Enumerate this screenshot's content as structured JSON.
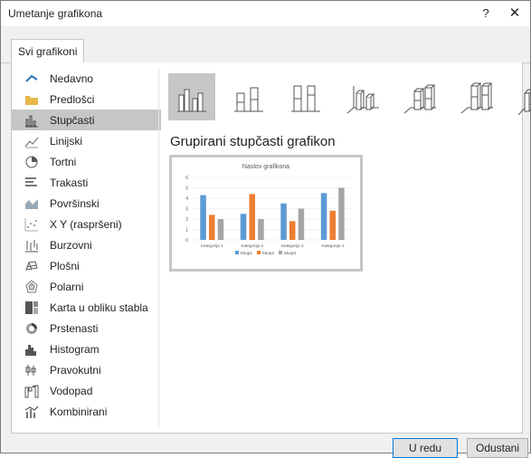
{
  "dialog": {
    "title": "Umetanje grafikona",
    "help_label": "?",
    "close_label": "✕"
  },
  "tab": {
    "label": "Svi grafikoni"
  },
  "categories": [
    {
      "label": "Nedavno",
      "icon": "recent-icon"
    },
    {
      "label": "Predlošci",
      "icon": "folder-icon"
    },
    {
      "label": "Stupčasti",
      "icon": "column-chart-icon",
      "selected": true
    },
    {
      "label": "Linijski",
      "icon": "line-chart-icon"
    },
    {
      "label": "Tortni",
      "icon": "pie-chart-icon"
    },
    {
      "label": "Trakasti",
      "icon": "bar-chart-icon"
    },
    {
      "label": "Površinski",
      "icon": "area-chart-icon"
    },
    {
      "label": "X Y (raspršeni)",
      "icon": "scatter-chart-icon"
    },
    {
      "label": "Burzovni",
      "icon": "stock-chart-icon"
    },
    {
      "label": "Plošni",
      "icon": "surface-chart-icon"
    },
    {
      "label": "Polarni",
      "icon": "radar-chart-icon"
    },
    {
      "label": "Karta u obliku stabla",
      "icon": "treemap-chart-icon"
    },
    {
      "label": "Prstenasti",
      "icon": "sunburst-chart-icon"
    },
    {
      "label": "Histogram",
      "icon": "histogram-chart-icon"
    },
    {
      "label": "Pravokutni",
      "icon": "box-whisker-chart-icon"
    },
    {
      "label": "Vodopad",
      "icon": "waterfall-chart-icon"
    },
    {
      "label": "Kombinirani",
      "icon": "combo-chart-icon"
    }
  ],
  "subtypes_selected_index": 0,
  "chart_type_heading": "Grupirani stupčasti grafikon",
  "chart_data": {
    "type": "bar",
    "title": "Naslov grafikona",
    "categories": [
      "Kategorija 1",
      "Kategorija 2",
      "Kategorija 3",
      "Kategorija 4"
    ],
    "series": [
      {
        "name": "Skup1",
        "values": [
          4.3,
          2.5,
          3.5,
          4.5
        ],
        "color": "#5b9bd5"
      },
      {
        "name": "Skup2",
        "values": [
          2.4,
          4.4,
          1.8,
          2.8
        ],
        "color": "#ed7d31"
      },
      {
        "name": "Skup3",
        "values": [
          2.0,
          2.0,
          3.0,
          5.0
        ],
        "color": "#a5a5a5"
      }
    ],
    "ylim": [
      0,
      6
    ],
    "yticks": [
      "0",
      "1",
      "2",
      "3",
      "4",
      "5",
      "6"
    ],
    "legend": "bottom"
  },
  "buttons": {
    "ok": "U redu",
    "cancel": "Odustani"
  }
}
